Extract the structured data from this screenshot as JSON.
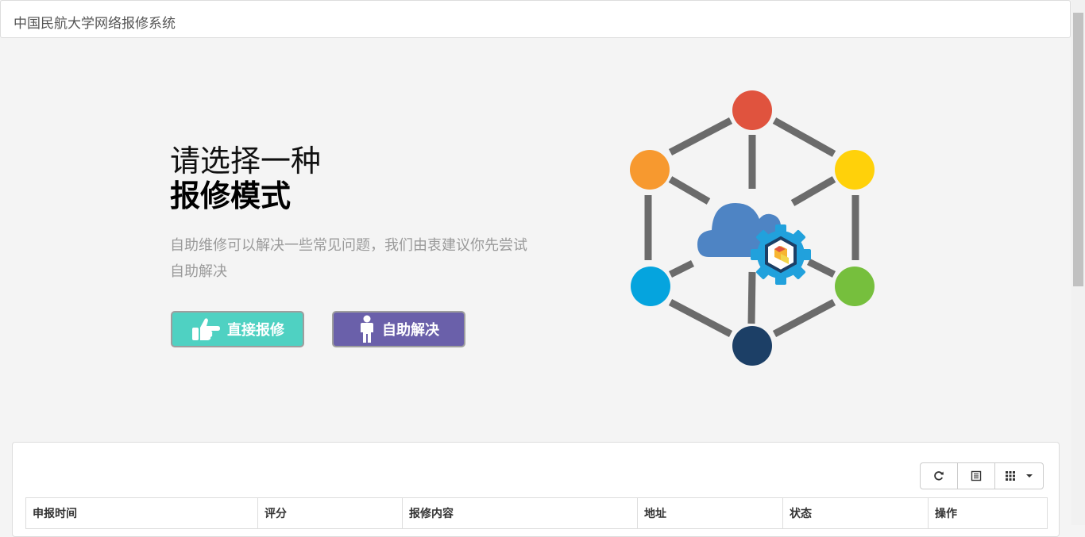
{
  "header": {
    "title": "中国民航大学网络报修系统"
  },
  "hero": {
    "headline_light": "请选择一种",
    "headline_bold": "报修模式",
    "description": "自助维修可以解决一些常见问题，我们由衷建议你先尝试自助解决"
  },
  "buttons": {
    "direct_label": "直接报修",
    "self_label": "自助解决",
    "direct_color": "#4fd1c2",
    "self_color": "#6a60aa"
  },
  "illustration": {
    "nodes": [
      "red",
      "yellow",
      "green",
      "navy",
      "blue",
      "orange"
    ],
    "node_colors": [
      "#e0533e",
      "#ffd10a",
      "#76bf3d",
      "#1c3f66",
      "#05a4de",
      "#f7992f"
    ],
    "center_icons": [
      "cloud-icon",
      "gear-icon"
    ]
  },
  "table": {
    "toolbar": [
      "refresh-icon",
      "toggle-view-icon",
      "columns-icon"
    ],
    "columns": [
      "申报时间",
      "评分",
      "报修内容",
      "地址",
      "状态",
      "操作"
    ]
  }
}
